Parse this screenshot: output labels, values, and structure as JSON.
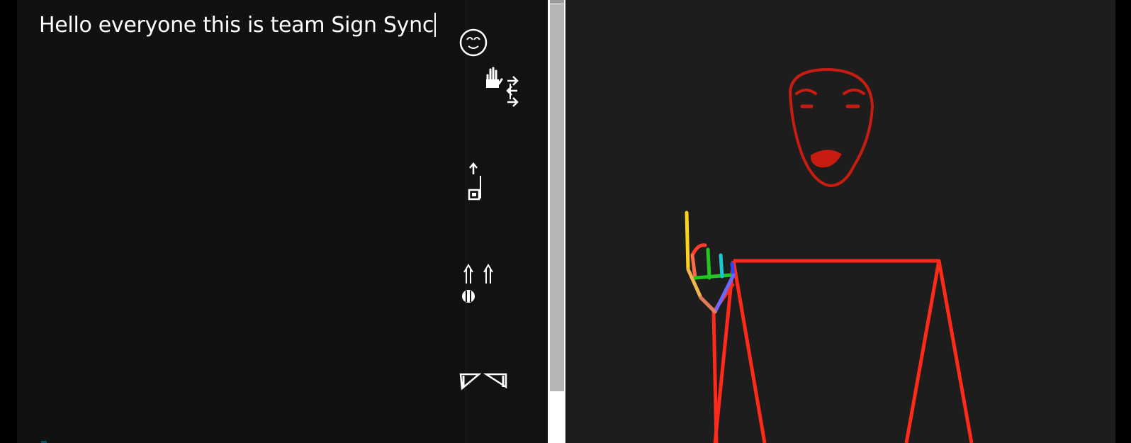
{
  "text_panel": {
    "input_text": "Hello everyone this is team Sign Sync"
  },
  "signwriting": {
    "glyphs": [
      {
        "name": "face-glyph",
        "icon": "face-circle-icon"
      },
      {
        "name": "hand-movement-glyph",
        "icon": "hand-arrows-icon"
      },
      {
        "name": "finger-up-glyph",
        "icon": "square-arrow-up-icon"
      },
      {
        "name": "double-arrows-glyph",
        "icon": "double-up-arrows-icon"
      },
      {
        "name": "triangle-hands-glyph",
        "icon": "triangle-pair-icon"
      }
    ]
  },
  "avatar": {
    "description_icon": "stick-figure-avatar-icon",
    "colors": {
      "body": "#ff2a1a",
      "face": "#c81c10",
      "thumb": "#ffd21a",
      "fingers": [
        "#ff3b2a",
        "#21c821",
        "#19c9d1",
        "#2846ff"
      ]
    }
  },
  "colors": {
    "background": "#000000",
    "panel": "#111111",
    "avatar_bg": "#1d1d1d",
    "scroll_thumb": "#b5b5b5"
  }
}
